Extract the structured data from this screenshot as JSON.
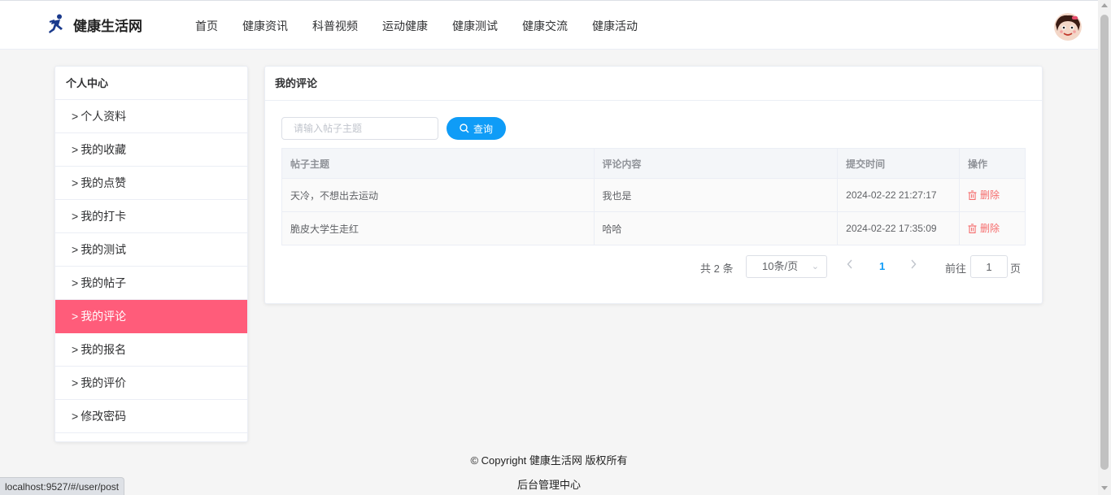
{
  "header": {
    "site_name": "健康生活网",
    "logo_icon": "running-man-icon",
    "nav": [
      "首页",
      "健康资讯",
      "科普视频",
      "运动健康",
      "健康测试",
      "健康交流",
      "健康活动"
    ],
    "avatar_icon": "cartoon-avatar-icon"
  },
  "sidebar": {
    "title": "个人中心",
    "items": [
      {
        "label": "个人资料"
      },
      {
        "label": "我的收藏"
      },
      {
        "label": "我的点赞"
      },
      {
        "label": "我的打卡"
      },
      {
        "label": "我的测试"
      },
      {
        "label": "我的帖子"
      },
      {
        "label": "我的评论"
      },
      {
        "label": "我的报名"
      },
      {
        "label": "我的评价"
      },
      {
        "label": "修改密码"
      }
    ],
    "active_index": 6,
    "chevron": ">"
  },
  "main": {
    "title": "我的评论",
    "search": {
      "placeholder": "请输入帖子主题",
      "value": ""
    },
    "search_button": "查询",
    "table": {
      "columns": [
        "帖子主题",
        "评论内容",
        "提交时间",
        "操作"
      ],
      "rows": [
        {
          "topic": "天冷，不想出去运动",
          "content": "我也是",
          "time": "2024-02-22 21:27:17",
          "action": "删除"
        },
        {
          "topic": "脆皮大学生走红",
          "content": "哈哈",
          "time": "2024-02-22 17:35:09",
          "action": "删除"
        }
      ]
    },
    "pagination": {
      "total": "共 2 条",
      "page_size": "10条/页",
      "current_page": "1",
      "goto_label": "前往",
      "goto_value": "1",
      "goto_unit": "页"
    }
  },
  "footer": {
    "copyright": "© Copyright 健康生活网 版权所有",
    "admin_link": "后台管理中心"
  },
  "status_bar": {
    "url": "localhost:9527/#/user/post"
  },
  "colors": {
    "accent": "#0f9cf7",
    "active_menu": "#ff5c7a",
    "danger": "#f56c6c"
  }
}
